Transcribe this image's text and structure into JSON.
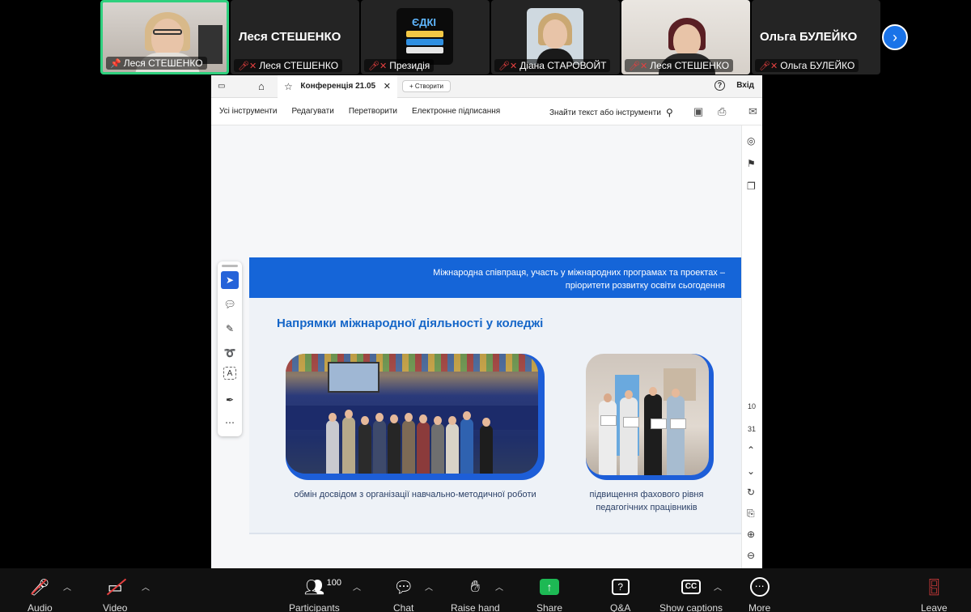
{
  "participants": [
    {
      "name": "Леся СТЕШЕНКО",
      "pinned": true,
      "video": true,
      "active": true
    },
    {
      "name": "Леся СТЕШЕНКО",
      "big_name": "Леся СТЕШЕНКО",
      "video": false
    },
    {
      "name": "Президія",
      "video": false,
      "thumb_text": "ЄДКІ"
    },
    {
      "name": "Діана СТАРОВОЙТ",
      "video": false
    },
    {
      "name": "Леся СТЕШЕНКО",
      "video": true
    },
    {
      "name": "Ольга БУЛЕЙКО",
      "big_name": "Ольга БУЛЕЙКО",
      "video": false
    }
  ],
  "pdf": {
    "tab_title": "Конференція 21.05",
    "new_tab": "+ Створити",
    "exit": "Вхід",
    "help": "?",
    "menu": [
      "Усі інструменти",
      "Редагувати",
      "Перетворити",
      "Електронне підписання"
    ],
    "search": "Знайти текст або інструменти",
    "page_current": "10",
    "page_total": "31"
  },
  "slide": {
    "header_line1": "Міжнародна співпраця, участь у міжнародних програмах та проектах –",
    "header_line2": "пріоритети розвитку освіти сьогодення",
    "title": "Напрямки міжнародної діяльності у коледжі",
    "caption1": "обмін досвідом з організації навчально-методичної роботи",
    "caption2": "підвищення фахового рівня педагогічних працівників"
  },
  "toolbar": {
    "audio": "Audio",
    "video": "Video",
    "participants": "Participants",
    "participants_count": "100",
    "chat": "Chat",
    "raise_hand": "Raise hand",
    "share": "Share",
    "qa": "Q&A",
    "captions": "Show captions",
    "more": "More",
    "leave": "Leave"
  },
  "colors": {
    "accent": "#1565d8",
    "active_speaker": "#2fd07e",
    "muted": "#e54040",
    "share_green": "#1db954",
    "leave_red": "#e54040"
  }
}
